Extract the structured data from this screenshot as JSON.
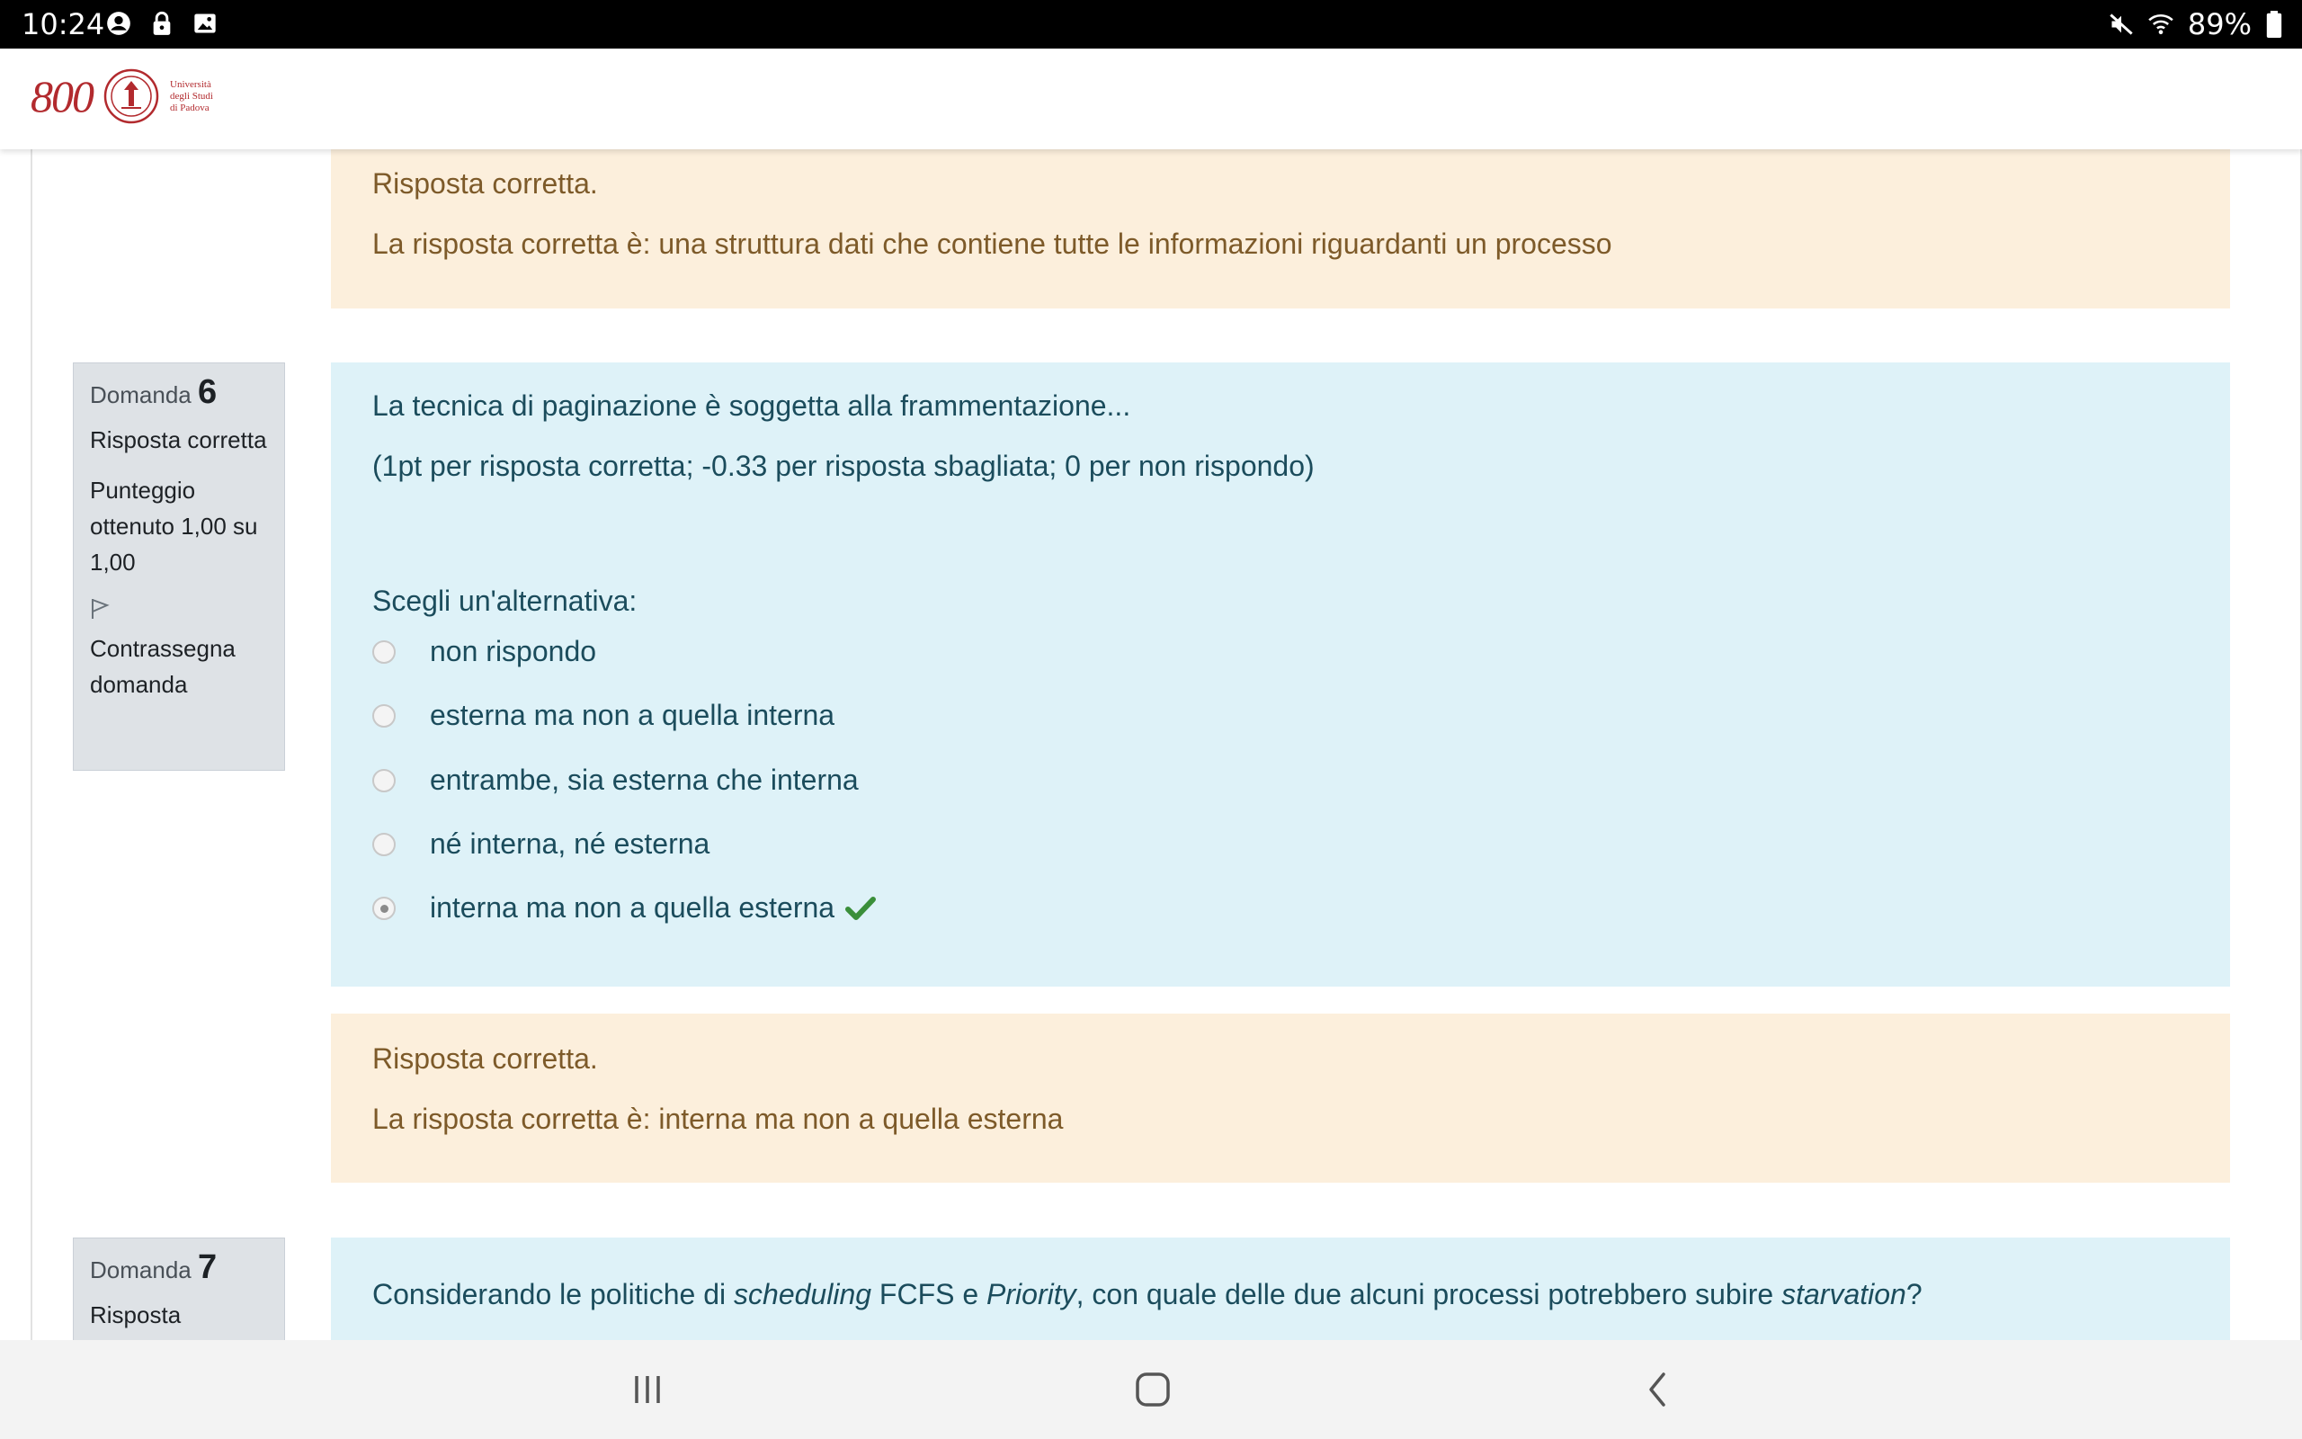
{
  "status_bar": {
    "time": "10:24",
    "battery": "89%",
    "left_icons": [
      "account-icon",
      "lock-icon",
      "image-icon"
    ],
    "right_icons": [
      "mute-icon",
      "wifi-icon",
      "battery-icon"
    ]
  },
  "header": {
    "logo_number": "800",
    "logo_text": [
      "Università",
      "degli Studi",
      "di Padova"
    ]
  },
  "q5_feedback": {
    "outcome": "Risposta corretta.",
    "right_answer": "La risposta corretta è: una struttura dati che contiene tutte le informazioni riguardanti un processo"
  },
  "q6": {
    "info": {
      "label": "Domanda",
      "number": "6",
      "state": "Risposta corretta",
      "grade": "Punteggio ottenuto 1,00 su 1,00",
      "flag_label": "Contrassegna domanda"
    },
    "question": "La tecnica di paginazione è soggetta alla frammentazione...",
    "scoring": "(1pt per risposta corretta; -0.33 per risposta sbagliata; 0 per non rispondo)",
    "prompt": "Scegli un'alternativa:",
    "options": [
      {
        "label": "non rispondo",
        "selected": false
      },
      {
        "label": "esterna ma non a quella interna",
        "selected": false
      },
      {
        "label": "entrambe, sia esterna che interna",
        "selected": false
      },
      {
        "label": "né interna, né esterna",
        "selected": false
      },
      {
        "label": "interna ma non a quella esterna",
        "selected": true
      }
    ],
    "feedback": {
      "outcome": "Risposta corretta.",
      "right_answer": "La risposta corretta è: interna ma non a quella esterna"
    }
  },
  "q7": {
    "info": {
      "label": "Domanda",
      "number": "7",
      "state": "Risposta"
    },
    "question_parts": [
      "Considerando le politiche di ",
      "scheduling",
      " FCFS e ",
      "Priority",
      ", con quale delle due alcuni processi potrebbero subire ",
      "starvation",
      "?"
    ]
  },
  "colors": {
    "feedback_bg": "#fcefdc",
    "formulation_bg": "#def2f8",
    "info_bg": "#dee2e6",
    "correct_check": "#3a8f3a",
    "brand_red": "#b22a2e"
  },
  "nav_bar": [
    "recent-apps-icon",
    "home-icon",
    "back-icon"
  ]
}
